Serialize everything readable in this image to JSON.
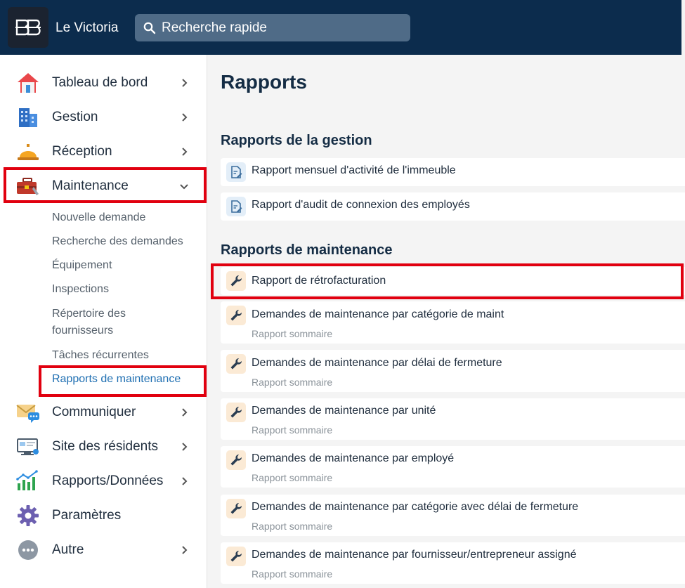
{
  "app": {
    "name": "Le Victoria"
  },
  "search": {
    "placeholder": "Recherche rapide"
  },
  "sidebar": {
    "items": [
      {
        "label": "Tableau de bord",
        "icon": "house-icon"
      },
      {
        "label": "Gestion",
        "icon": "building-icon"
      },
      {
        "label": "Réception",
        "icon": "service-bell-icon"
      },
      {
        "label": "Maintenance",
        "icon": "toolbox-icon",
        "expanded": true
      },
      {
        "label": "Communiquer",
        "icon": "mail-chat-icon"
      },
      {
        "label": "Site des résidents",
        "icon": "resident-portal-icon"
      },
      {
        "label": "Rapports/Données",
        "icon": "bar-chart-icon"
      },
      {
        "label": "Paramètres",
        "icon": "gear-icon"
      },
      {
        "label": "Autre",
        "icon": "more-icon"
      }
    ],
    "maintenance_sub": [
      {
        "label": "Nouvelle demande"
      },
      {
        "label": "Recherche des demandes"
      },
      {
        "label": "Équipement"
      },
      {
        "label": "Inspections"
      },
      {
        "label": "Répertoire des fournisseurs"
      },
      {
        "label": "Tâches récurrentes"
      },
      {
        "label": "Rapports de maintenance",
        "active": true
      }
    ]
  },
  "main": {
    "title": "Rapports",
    "gestion": {
      "title": "Rapports de la gestion",
      "reports": [
        {
          "title": "Rapport mensuel d'activité de l'immeuble"
        },
        {
          "title": "Rapport d'audit de connexion des employés"
        }
      ]
    },
    "maintenance": {
      "title": "Rapports de maintenance",
      "reports": [
        {
          "title": "Rapport de rétrofacturation",
          "subtitle": ""
        },
        {
          "title": "Demandes de maintenance par catégorie de maint",
          "subtitle": "Rapport sommaire"
        },
        {
          "title": "Demandes de maintenance par délai de fermeture",
          "subtitle": "Rapport sommaire"
        },
        {
          "title": "Demandes de maintenance par unité",
          "subtitle": "Rapport sommaire"
        },
        {
          "title": "Demandes de maintenance par employé",
          "subtitle": "Rapport sommaire"
        },
        {
          "title": "Demandes de maintenance par catégorie avec délai de fermeture",
          "subtitle": "Rapport sommaire"
        },
        {
          "title": "Demandes de maintenance par fournisseur/entrepreneur assigné",
          "subtitle": "Rapport sommaire"
        }
      ]
    }
  },
  "colors": {
    "topbar": "#0c2c4d",
    "highlight": "#e1000f",
    "active_link": "#1f6fb2"
  }
}
